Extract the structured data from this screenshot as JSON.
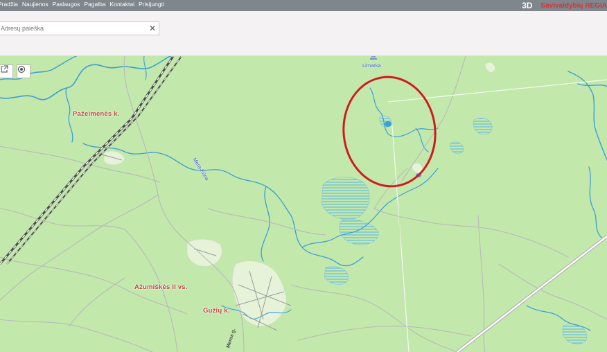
{
  "nav": {
    "items": [
      "Pradžia",
      "Naujienos",
      "Paslaugos",
      "Pagalba",
      "Kontaktai",
      "Prisijungti"
    ]
  },
  "brand": {
    "badge": "3D",
    "name": "Savivaldybių REGIA"
  },
  "search": {
    "placeholder": "Adresų paieška",
    "value": ""
  },
  "map": {
    "labels": {
      "pazeimenes": "Pažeimenės k.",
      "limarka": "Limarka",
      "mera_kuna": "Mera-Kūna",
      "azumiskes": "Ažumiškės II vs.",
      "guziu": "Gužių k.",
      "meros": "Meros g."
    },
    "colors": {
      "forest": "#c2e8ab",
      "water": "#3a9fd6",
      "road": "#b9b9bc",
      "railway": "#4a4a4a",
      "highlight": "#d11a1f"
    }
  }
}
